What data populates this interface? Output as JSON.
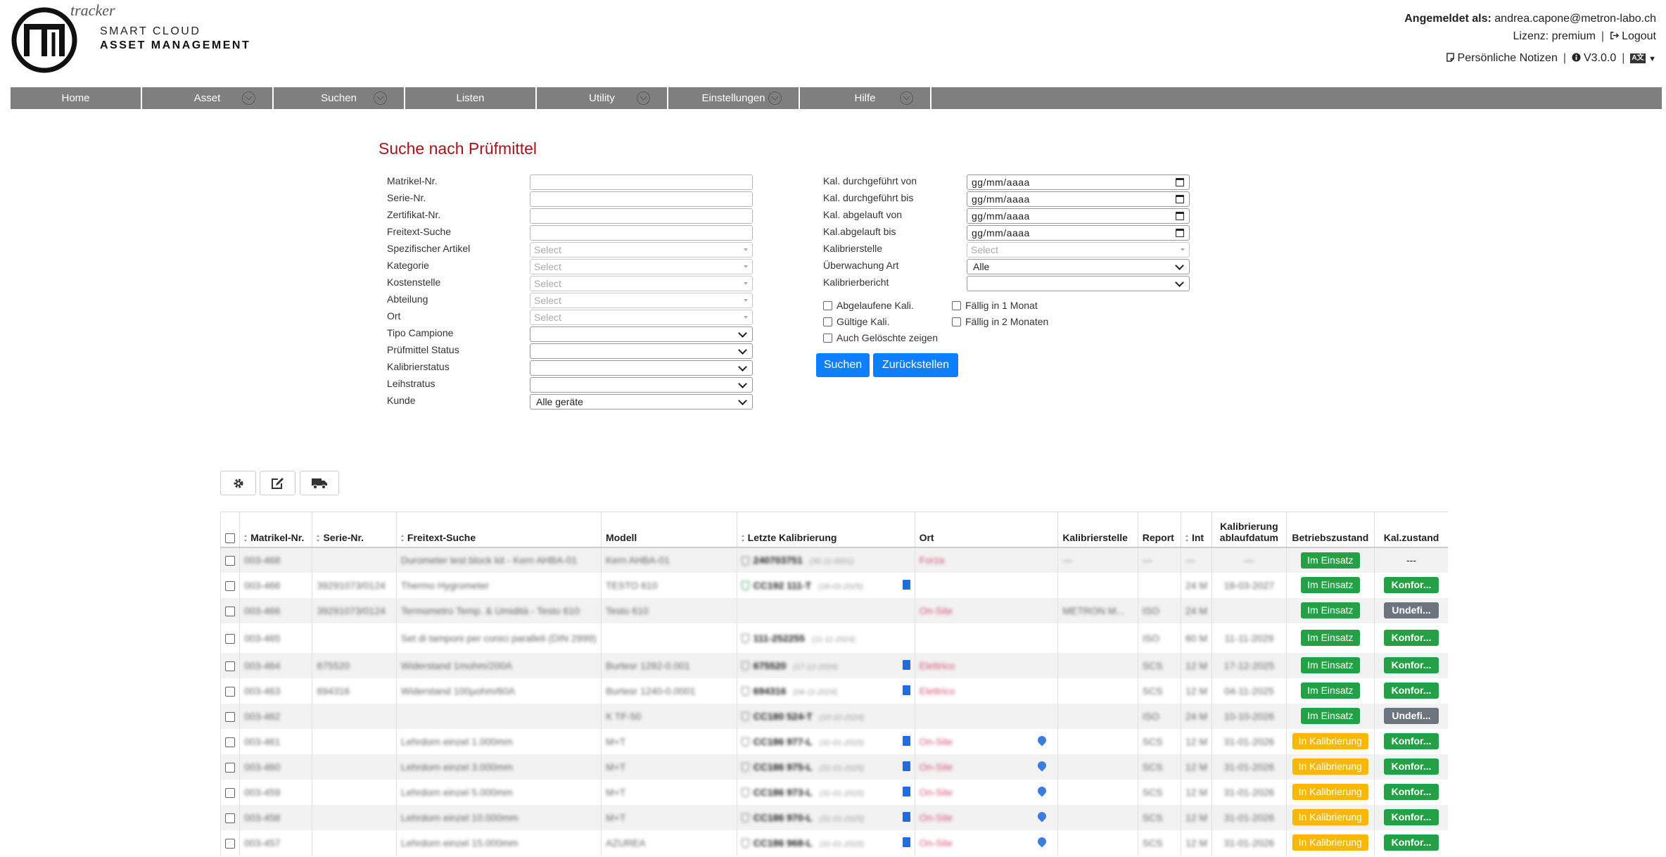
{
  "brand": {
    "tracker": "tracker",
    "line1": "SMART CLOUD",
    "line2": "ASSET MANAGEMENT"
  },
  "user": {
    "logged_label": "Angemeldet als:",
    "email": "andrea.capone@metron-labo.ch",
    "license": "Lizenz: premium",
    "logout": "Logout",
    "notes": "Persönliche Notizen",
    "version": "V3.0.0",
    "lang": "A文"
  },
  "nav": [
    {
      "label": "Home",
      "chev": false
    },
    {
      "label": "Asset",
      "chev": true
    },
    {
      "label": "Suchen",
      "chev": true
    },
    {
      "label": "Listen",
      "chev": false
    },
    {
      "label": "Utility",
      "chev": true
    },
    {
      "label": "Einstellungen",
      "chev": true
    },
    {
      "label": "Hilfe",
      "chev": true
    }
  ],
  "form": {
    "title": "Suche nach Prüfmittel",
    "left_fields": [
      {
        "label": "Matrikel-Nr.",
        "kind": "text",
        "value": ""
      },
      {
        "label": "Serie-Nr.",
        "kind": "text",
        "value": ""
      },
      {
        "label": "Zertifikat-Nr.",
        "kind": "text",
        "value": ""
      },
      {
        "label": "Freitext-Suche",
        "kind": "text",
        "value": ""
      },
      {
        "label": "Spezifischer Artikel",
        "kind": "select",
        "value": "Select"
      },
      {
        "label": "Kategorie",
        "kind": "select",
        "value": "Select"
      },
      {
        "label": "Kostenstelle",
        "kind": "select",
        "value": "Select"
      },
      {
        "label": "Abteilung",
        "kind": "select",
        "value": "Select"
      },
      {
        "label": "Ort",
        "kind": "select",
        "value": "Select"
      },
      {
        "label": "Tipo Campione",
        "kind": "drop",
        "value": ""
      },
      {
        "label": "Prüfmittel Status",
        "kind": "drop",
        "value": ""
      },
      {
        "label": "Kalibrierstatus",
        "kind": "drop",
        "value": ""
      },
      {
        "label": "Leihstratus",
        "kind": "drop",
        "value": ""
      },
      {
        "label": "Kunde",
        "kind": "drop",
        "value": "Alle geräte"
      }
    ],
    "right_fields": [
      {
        "label": "Kal. durchgeführt von",
        "kind": "date",
        "value": "gg/mm/aaaa"
      },
      {
        "label": "Kal. durchgeführt bis",
        "kind": "date",
        "value": "gg/mm/aaaa"
      },
      {
        "label": "Kal. abgelauft von",
        "kind": "date",
        "value": "gg/mm/aaaa"
      },
      {
        "label": "Kal.abgelauft bis",
        "kind": "date",
        "value": "gg/mm/aaaa"
      },
      {
        "label": "Kalibrierstelle",
        "kind": "select",
        "value": "Select"
      },
      {
        "label": "Überwachung Art",
        "kind": "drop",
        "value": "Alle"
      },
      {
        "label": "Kalibrierbericht",
        "kind": "drop",
        "value": ""
      }
    ],
    "checkboxes": {
      "expired": "Abgelaufene Kali.",
      "due1": "Fällig in 1 Monat",
      "valid": "Gültige Kali.",
      "due2": "Fällig in 2 Monaten",
      "deleted": "Auch Gelöschte zeigen"
    },
    "search_btn": "Suchen",
    "reset_btn": "Zurückstellen"
  },
  "table": {
    "headers": [
      "",
      "Matrikel-Nr.",
      "Serie-Nr.",
      "Freitext-Suche",
      "Modell",
      "Letzte Kalibrierung",
      "Ort",
      "Kalibrierstelle",
      "Report",
      "Int",
      "Kalibrierung ablaufdatum",
      "Betriebszustand",
      "Kal.zustand"
    ],
    "rows": [
      {
        "mat": "003-468",
        "ser": "",
        "txt": "Durometer test block kit - Kern AHBA-01",
        "mod": "Kern AHBA-01",
        "cal": "240703751",
        "cald": "(30-11-0001)",
        "shield": "grey",
        "doc": false,
        "ort": "Forza",
        "pin": false,
        "stelle": "---",
        "rep": "---",
        "int": "---",
        "abl": "---",
        "status": "Im Einsatz",
        "scls": "g",
        "kz": "---",
        "kzcls": ""
      },
      {
        "mat": "003-466",
        "ser": "39291073/0124",
        "txt": "Thermo Hygrometer",
        "mod": "TESTO 610",
        "cal": "CC192 111-T",
        "cald": "(18-03-2025)",
        "shield": "green",
        "doc": true,
        "ort": "",
        "pin": false,
        "stelle": "",
        "rep": "",
        "int": "24 M",
        "abl": "18-03-2027",
        "status": "Im Einsatz",
        "scls": "g",
        "kz": "Konfor...",
        "kzcls": "g"
      },
      {
        "mat": "003-466",
        "ser": "39291073/0124",
        "txt": "Termometro Temp. & Umidità - Testo 610",
        "mod": "Testo 610",
        "cal": "",
        "cald": "",
        "shield": "",
        "doc": false,
        "ort": "On-Site",
        "pin": false,
        "stelle": "METRON M...",
        "rep": "ISO",
        "int": "24 M",
        "abl": "",
        "status": "Im Einsatz",
        "scls": "g",
        "kz": "Undefi...",
        "kzcls": "gr"
      },
      {
        "mat": "003-465",
        "ser": "",
        "txt": "Set di tamponi per conici paralleli (DIN 2999)",
        "mod": "",
        "cal": "111-252255",
        "cald": "(11-11-2024)",
        "shield": "grey",
        "doc": false,
        "ort": "",
        "pin": false,
        "stelle": "",
        "rep": "ISO",
        "int": "60 M",
        "abl": "11-11-2029",
        "status": "Im Einsatz",
        "scls": "g",
        "kz": "Konfor...",
        "kzcls": "g",
        "tall": true
      },
      {
        "mat": "003-464",
        "ser": "675520",
        "txt": "Widerstand 1mohm/200A",
        "mod": "Burtesr 1282-0.001",
        "cal": "675520",
        "cald": "(17-12-2024)",
        "shield": "grey",
        "doc": true,
        "ort": "Elettrico",
        "pin": false,
        "stelle": "",
        "rep": "SCS",
        "int": "12 M",
        "abl": "17-12-2025",
        "status": "Im Einsatz",
        "scls": "g",
        "kz": "Konfor...",
        "kzcls": "g"
      },
      {
        "mat": "003-463",
        "ser": "694316",
        "txt": "Widerstand 100µohm/60A",
        "mod": "Burtesr 1240-0.0001",
        "cal": "694316",
        "cald": "(04-11-2024)",
        "shield": "grey",
        "doc": true,
        "ort": "Elettrico",
        "pin": false,
        "stelle": "",
        "rep": "SCS",
        "int": "12 M",
        "abl": "04-11-2025",
        "status": "Im Einsatz",
        "scls": "g",
        "kz": "Konfor...",
        "kzcls": "g"
      },
      {
        "mat": "003-462",
        "ser": "",
        "txt": "",
        "mod": "K TF-50",
        "cal": "CC180 524-T",
        "cald": "(10-10-2024)",
        "shield": "grey",
        "doc": false,
        "ort": "",
        "pin": false,
        "stelle": "",
        "rep": "ISO",
        "int": "24 M",
        "abl": "10-10-2026",
        "status": "Im Einsatz",
        "scls": "g",
        "kz": "Undefi...",
        "kzcls": "gr"
      },
      {
        "mat": "003-461",
        "ser": "",
        "txt": "Lehrdorn einzel 1.000mm",
        "mod": "M+T",
        "cal": "CC186 977-L",
        "cald": "(31-01-2025)",
        "shield": "grey",
        "doc": true,
        "ort": "On-Site",
        "pin": true,
        "stelle": "",
        "rep": "SCS",
        "int": "12 M",
        "abl": "31-01-2026",
        "status": "In Kalibrierung",
        "scls": "y",
        "kz": "Konfor...",
        "kzcls": "g"
      },
      {
        "mat": "003-460",
        "ser": "",
        "txt": "Lehrdorn einzel 3.000mm",
        "mod": "M+T",
        "cal": "CC186 975-L",
        "cald": "(31-01-2025)",
        "shield": "grey",
        "doc": true,
        "ort": "On-Site",
        "pin": true,
        "stelle": "",
        "rep": "SCS",
        "int": "12 M",
        "abl": "31-01-2026",
        "status": "In Kalibrierung",
        "scls": "y",
        "kz": "Konfor...",
        "kzcls": "g"
      },
      {
        "mat": "003-459",
        "ser": "",
        "txt": "Lehrdorn einzel 5.000mm",
        "mod": "M+T",
        "cal": "CC186 973-L",
        "cald": "(31-01-2025)",
        "shield": "grey",
        "doc": true,
        "ort": "On-Site",
        "pin": true,
        "stelle": "",
        "rep": "SCS",
        "int": "12 M",
        "abl": "31-01-2026",
        "status": "In Kalibrierung",
        "scls": "y",
        "kz": "Konfor...",
        "kzcls": "g"
      },
      {
        "mat": "003-458",
        "ser": "",
        "txt": "Lehrdorn einzel 10.000mm",
        "mod": "M+T",
        "cal": "CC186 970-L",
        "cald": "(31-01-2025)",
        "shield": "grey",
        "doc": true,
        "ort": "On-Site",
        "pin": true,
        "stelle": "",
        "rep": "SCS",
        "int": "12 M",
        "abl": "31-01-2026",
        "status": "In Kalibrierung",
        "scls": "y",
        "kz": "Konfor...",
        "kzcls": "g"
      },
      {
        "mat": "003-457",
        "ser": "",
        "txt": "Lehrdorn einzel 15.000mm",
        "mod": "AZUREA",
        "cal": "CC186 968-L",
        "cald": "(31-01-2025)",
        "shield": "grey",
        "doc": true,
        "ort": "On-Site",
        "pin": true,
        "stelle": "",
        "rep": "SCS",
        "int": "12 M",
        "abl": "31-01-2026",
        "status": "In Kalibrierung",
        "scls": "y",
        "kz": "Konfor...",
        "kzcls": "g"
      }
    ]
  },
  "colors": {
    "nav_bg": "#7f7f7f",
    "title_red": "#a3141e",
    "primary": "#0d7fff",
    "green": "#26a046",
    "yellow": "#f8b805",
    "grey": "#6c757d"
  }
}
